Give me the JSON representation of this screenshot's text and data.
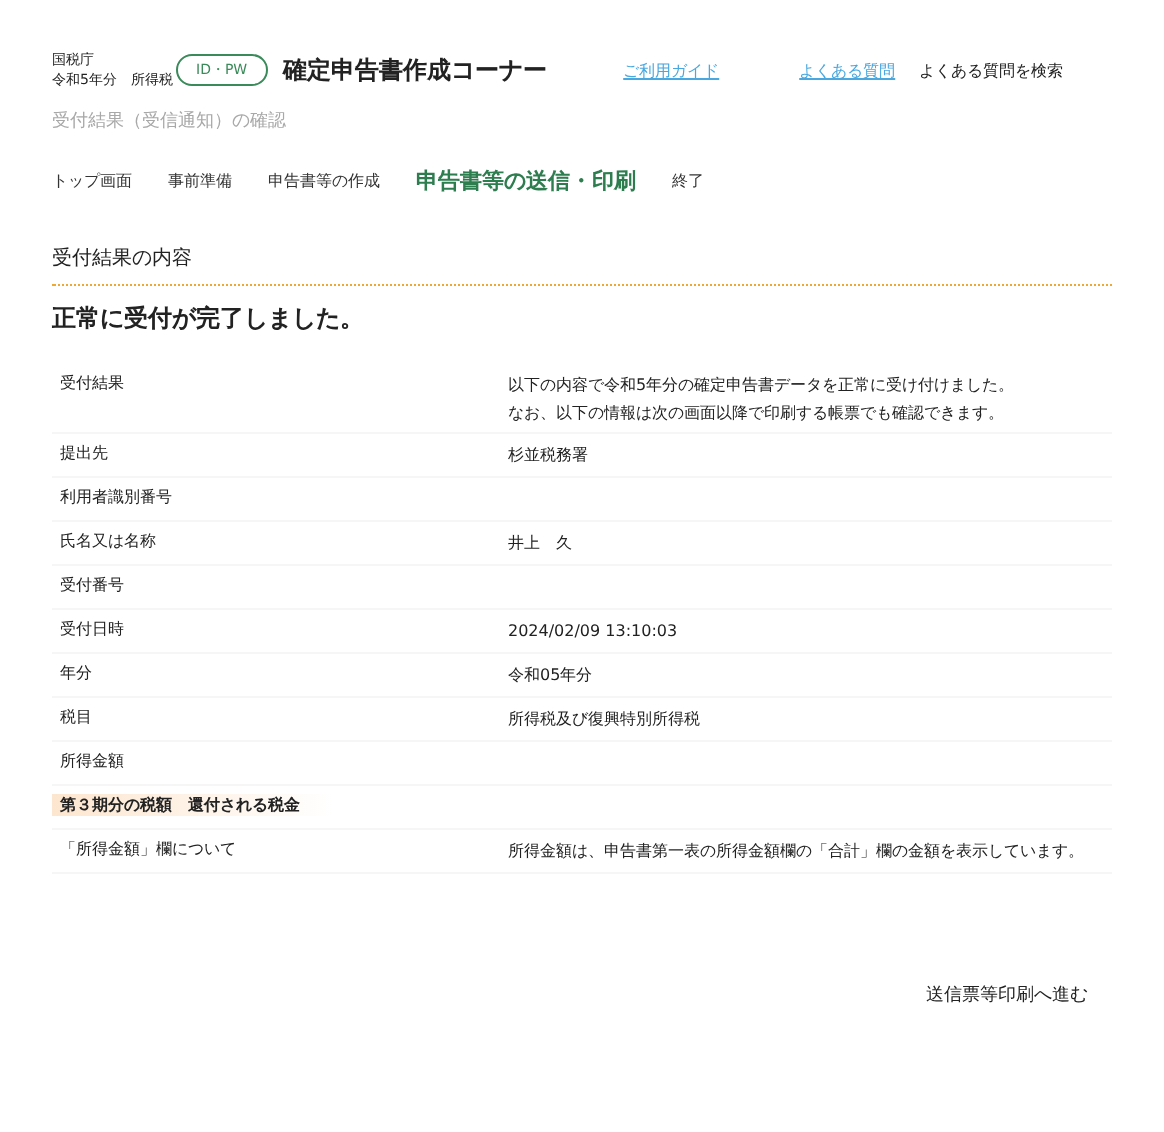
{
  "header": {
    "agency": "国税庁",
    "year_label": "令和5年分　所得税",
    "login_badge": "ID・PW",
    "title": "確定申告書作成コーナー",
    "links": [
      "ご利用ガイド",
      "よくある質問"
    ],
    "search_label": "よくある質問を検索"
  },
  "page_title": "受付結果（受信通知）の確認",
  "steps": [
    {
      "label": "トップ画面",
      "selected": false
    },
    {
      "label": "事前準備",
      "selected": false
    },
    {
      "label": "申告書等の作成",
      "selected": false
    },
    {
      "label": "申告書等の送信・印刷",
      "selected": true
    },
    {
      "label": "終了",
      "selected": false
    }
  ],
  "section_title": "受付結果の内容",
  "message": "正常に受付が完了しました。",
  "rows": [
    {
      "label": "受付結果",
      "value": [
        "以下の内容で令和5年分の確定申告書データを正常に受け付けました。",
        "なお、以下の情報は次の画面以降で印刷する帳票でも確認できます。"
      ],
      "highlighted": false
    },
    {
      "label": "提出先",
      "value": [
        "杉並税務署"
      ],
      "highlighted": false
    },
    {
      "label": "利用者識別番号",
      "value": [],
      "highlighted": false
    },
    {
      "label": "氏名又は名称",
      "value": [
        "井上　久"
      ],
      "highlighted": false
    },
    {
      "label": "受付番号",
      "value": [],
      "highlighted": false
    },
    {
      "label": "受付日時",
      "value": [
        "2024/02/09 13:10:03"
      ],
      "highlighted": false
    },
    {
      "label": "年分",
      "value": [
        "令和05年分"
      ],
      "highlighted": false
    },
    {
      "label": "税目",
      "value": [
        "所得税及び復興特別所得税"
      ],
      "highlighted": false
    },
    {
      "label": "所得金額",
      "value": [],
      "highlighted": false
    },
    {
      "label": "第３期分の税額　還付される税金",
      "value": [],
      "highlighted": true
    },
    {
      "label": "「所得金額」欄について",
      "value": [
        "所得金額は、申告書第一表の所得金額欄の「合計」欄の金額を表示しています。"
      ],
      "highlighted": false
    }
  ],
  "next_button": "送信票等印刷へ進む"
}
